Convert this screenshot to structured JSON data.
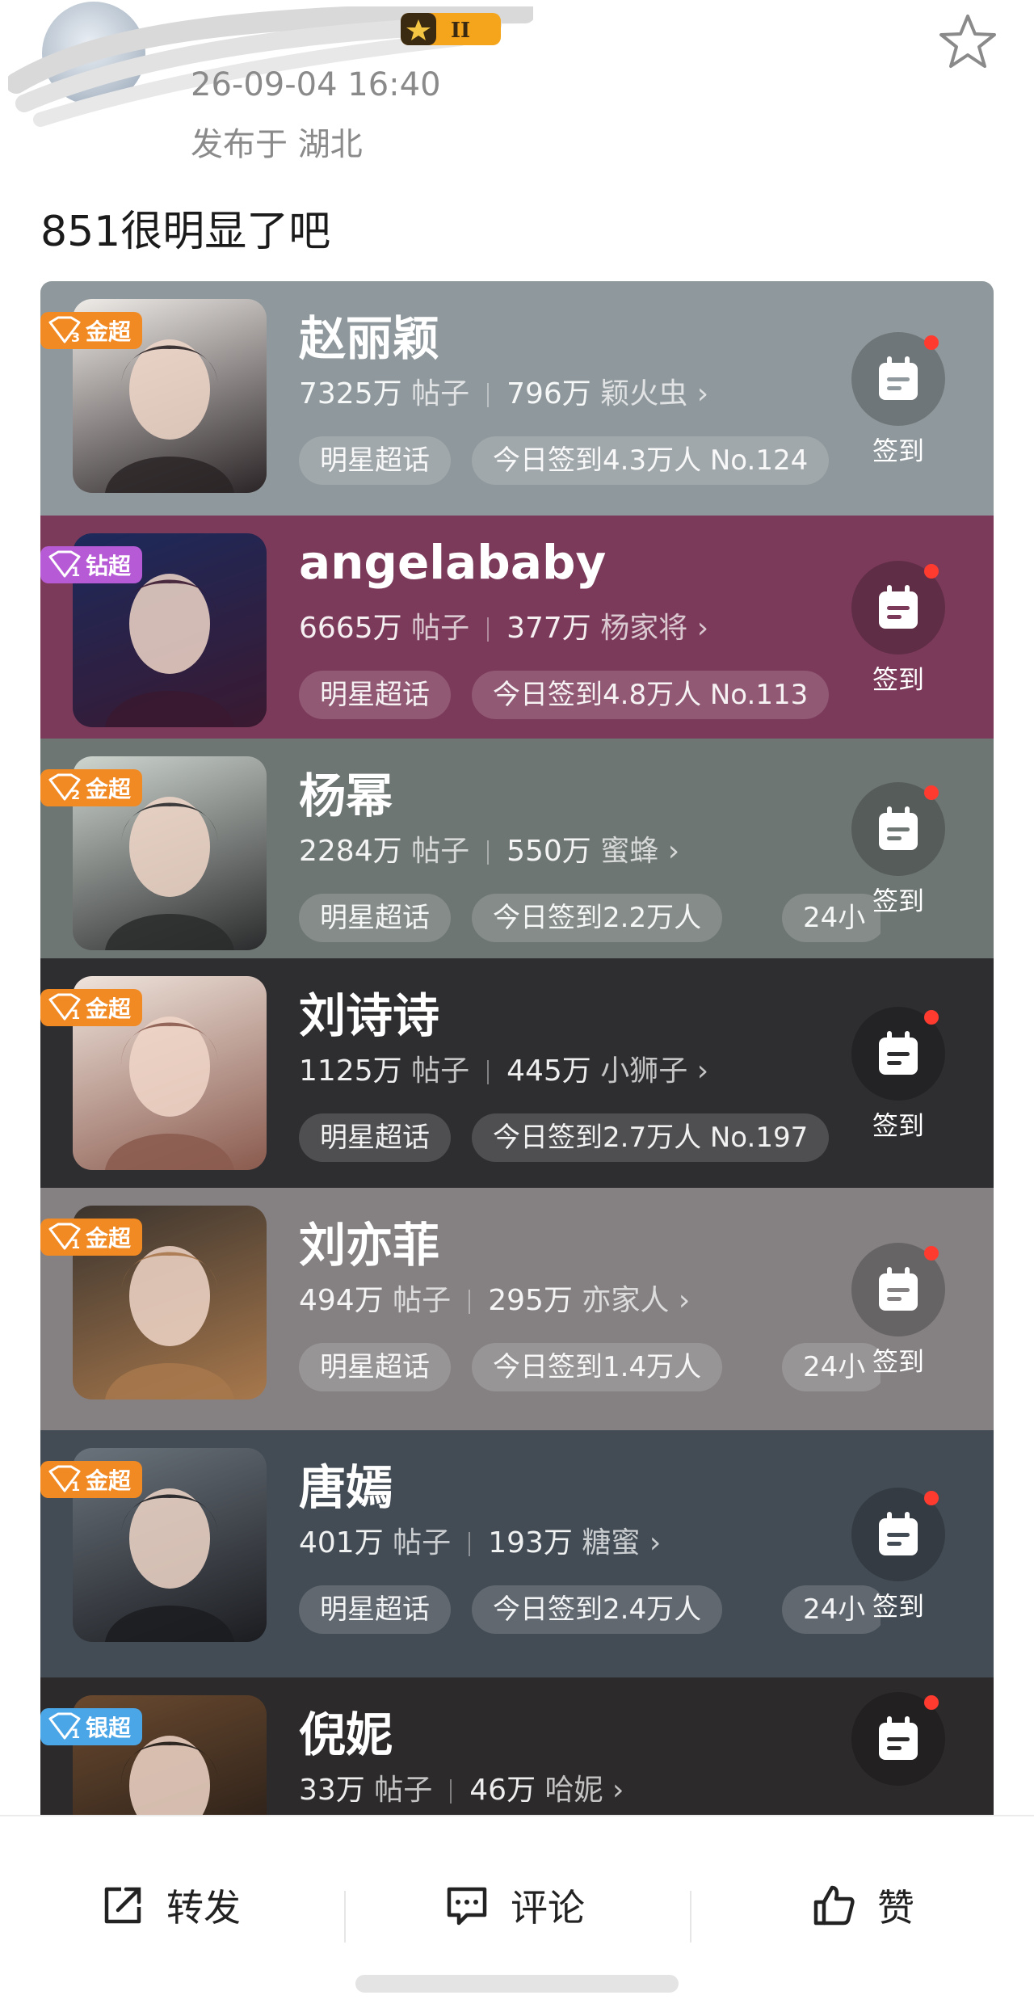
{
  "post": {
    "time": "26-09-04 16:40",
    "location": "发布于 湖北",
    "level_badge": "II",
    "text": "851很明显了吧"
  },
  "topics": [
    {
      "name": "赵丽颖",
      "tier_rank": "3",
      "tier": "金超",
      "tier_color": "#f28a24",
      "posts": "7325万",
      "posts_label": "帖子",
      "fans": "796万",
      "fans_name": "颖火虫",
      "category": "明星超话",
      "checkin_today": "今日签到4.3万人 No.124",
      "extra": "",
      "checkin_label": "签到",
      "bg": "#8f989c"
    },
    {
      "name": "angelababy",
      "tier_rank": "1",
      "tier": "钻超",
      "tier_color": "#b65ad6",
      "posts": "6665万",
      "posts_label": "帖子",
      "fans": "377万",
      "fans_name": "杨家将",
      "category": "明星超话",
      "checkin_today": "今日签到4.8万人 No.113",
      "extra": "",
      "checkin_label": "签到",
      "bg": "#7c3a5a"
    },
    {
      "name": "杨幂",
      "tier_rank": "2",
      "tier": "金超",
      "tier_color": "#f28a24",
      "posts": "2284万",
      "posts_label": "帖子",
      "fans": "550万",
      "fans_name": "蜜蜂",
      "category": "明星超话",
      "checkin_today": "今日签到2.2万人",
      "extra": "24小",
      "checkin_label": "签到",
      "bg": "#6e7674"
    },
    {
      "name": "刘诗诗",
      "tier_rank": "1",
      "tier": "金超",
      "tier_color": "#f28a24",
      "posts": "1125万",
      "posts_label": "帖子",
      "fans": "445万",
      "fans_name": "小狮子",
      "category": "明星超话",
      "checkin_today": "今日签到2.7万人 No.197",
      "extra": "",
      "checkin_label": "签到",
      "bg": "#2e2e31"
    },
    {
      "name": "刘亦菲",
      "tier_rank": "1",
      "tier": "金超",
      "tier_color": "#f28a24",
      "posts": "494万",
      "posts_label": "帖子",
      "fans": "295万",
      "fans_name": "亦家人",
      "category": "明星超话",
      "checkin_today": "今日签到1.4万人",
      "extra": "24小",
      "checkin_label": "签到",
      "bg": "#858183"
    },
    {
      "name": "唐嫣",
      "tier_rank": "1",
      "tier": "金超",
      "tier_color": "#f28a24",
      "posts": "401万",
      "posts_label": "帖子",
      "fans": "193万",
      "fans_name": "糖蜜",
      "category": "明星超话",
      "checkin_today": "今日签到2.4万人",
      "extra": "24小",
      "checkin_label": "签到",
      "bg": "#434c55"
    },
    {
      "name": "倪妮",
      "tier_rank": "1",
      "tier": "银超",
      "tier_color": "#4aa6e6",
      "posts": "33万",
      "posts_label": "帖子",
      "fans": "46万",
      "fans_name": "哈妮",
      "category": "",
      "checkin_today": "",
      "extra": "",
      "checkin_label": "",
      "bg": "#2c2a2a"
    }
  ],
  "actions": {
    "repost": "转发",
    "comment": "评论",
    "like": "赞"
  }
}
